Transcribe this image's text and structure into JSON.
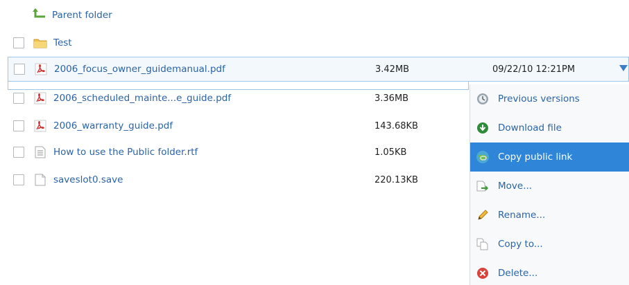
{
  "parent": {
    "label": "Parent folder"
  },
  "folder": {
    "name": "Test"
  },
  "files": [
    {
      "name": "2006_focus_owner_guidemanual.pdf",
      "size": "3.42MB",
      "date": "09/22/10  12:21PM",
      "icon": "pdf-icon"
    },
    {
      "name": "2006_scheduled_mainte...e_guide.pdf",
      "size": "3.36MB",
      "icon": "pdf-icon"
    },
    {
      "name": "2006_warranty_guide.pdf",
      "size": "143.68KB",
      "icon": "pdf-icon"
    },
    {
      "name": "How to use the Public folder.rtf",
      "size": "1.05KB",
      "icon": "text-document-icon"
    },
    {
      "name": "saveslot0.save",
      "size": "220.13KB",
      "icon": "blank-file-icon"
    }
  ],
  "menu": {
    "items": [
      {
        "label": "Previous versions",
        "icon": "history-icon"
      },
      {
        "label": "Download file",
        "icon": "download-icon"
      },
      {
        "label": "Copy public link",
        "icon": "public-link-icon",
        "highlighted": true
      },
      {
        "label": "Move...",
        "icon": "move-icon"
      },
      {
        "label": "Rename...",
        "icon": "rename-pencil-icon"
      },
      {
        "label": "Copy to...",
        "icon": "copy-icon"
      },
      {
        "label": "Delete...",
        "icon": "delete-icon"
      }
    ]
  },
  "colors": {
    "link": "#2a63a6",
    "highlight": "#2f86d8",
    "selection_border": "#9cc4e6"
  }
}
